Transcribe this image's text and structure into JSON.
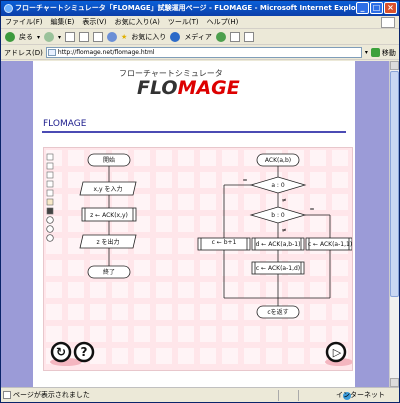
{
  "window": {
    "title": "フローチャートシミュレータ「FLOMAGE」試験運用ページ - FLOMAGE - Microsoft Internet Explorer",
    "min": "_",
    "max": "□",
    "close": "×"
  },
  "menu": [
    "ファイル(F)",
    "編集(E)",
    "表示(V)",
    "お気に入り(A)",
    "ツール(T)",
    "ヘルプ(H)"
  ],
  "toolbar": {
    "back": "戻る",
    "favorites": "お気に入り",
    "media": "メディア"
  },
  "address": {
    "label": "アドレス(D)",
    "url": "http://flomage.net/flomage.html",
    "go": "移動"
  },
  "page": {
    "subtitle": "フローチャートシミュレータ",
    "logo_left": "FLO",
    "logo_right": "MAGE",
    "heading": "FLOMAGE"
  },
  "flow_left": {
    "start": "開始",
    "input": "x,y を入力",
    "call": "z ← ACK(x,y)",
    "output": "z を出力",
    "end": "終了"
  },
  "flow_right": {
    "func": "ACK(a,b)",
    "cond1": "a : 0",
    "cond2": "b : 0",
    "eq1": "=",
    "ne1": "≠",
    "eq2": "=",
    "ne2": "≠",
    "box_c1": "c ← b+1",
    "box_d": "d ← ACK(a,b-1)",
    "box_c2": "c ← ACK(a-1,1)",
    "box_c3": "c ← ACK(a-1,d)",
    "ret": "cを返す"
  },
  "controls": {
    "rotate": "↻",
    "help": "?",
    "play": "▷"
  },
  "status": {
    "text": "ページが表示されました",
    "zone": "インターネット"
  },
  "colors": {
    "background_panel": "#9b9bd7",
    "sim_bg": "#ffe6ea",
    "heading": "#1c1c8c",
    "logo_red": "#dd0000"
  }
}
